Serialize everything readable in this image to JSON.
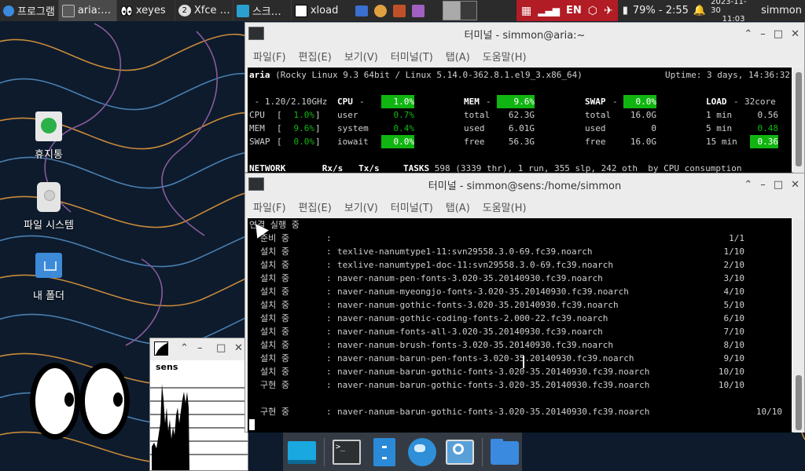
{
  "panel": {
    "apps_menu_label": "프로그램",
    "tasks": [
      {
        "label": "aria:…",
        "icon": "terminal-icon"
      },
      {
        "label": "xeyes",
        "icon": "eyes-icon"
      },
      {
        "label": "Xfce …",
        "icon": "xfce-icon",
        "badge": "2"
      },
      {
        "label": "스크…",
        "icon": "screenshot-icon"
      },
      {
        "label": "xload",
        "icon": "xload-icon"
      }
    ],
    "lang": "EN",
    "battery": "79% - 2:55",
    "date": "2023-11-30",
    "time": "11:03",
    "user": "simmon"
  },
  "desktop_icons": [
    {
      "label": "휴지통",
      "icon": "trash-icon"
    },
    {
      "label": "파일 시스템",
      "icon": "drive-icon"
    },
    {
      "label": "내 폴더",
      "icon": "home-folder-icon"
    }
  ],
  "menu": [
    "파일(F)",
    "편집(E)",
    "보기(V)",
    "터미널(T)",
    "탭(A)",
    "도움말(H)"
  ],
  "win1": {
    "title": "터미널 - simmon@aria:~",
    "host": "aria",
    "sysinfo": " (Rocky Linux 9.3 64bit / Linux 5.14.0-362.8.1.el9_3.x86_64)",
    "uptime": "Uptime: 3 days, 14:36:32",
    "freq": " - 1.20/2.10GHz",
    "cpu_label": "CPU",
    "cpu_pct": "1.0%",
    "cpu_rows": [
      {
        "label": "CPU",
        "bar": "1.0%",
        "name": "user",
        "val": "0.7%"
      },
      {
        "label": "MEM",
        "bar": "9.6%",
        "name": "system",
        "val": "0.4%"
      },
      {
        "label": "SWAP",
        "bar": "0.0%",
        "name": "iowait",
        "val": "0.0%"
      }
    ],
    "mem_label": "MEM",
    "mem_pct": "9.6%",
    "mem_rows": [
      {
        "name": "total",
        "val": "62.3G"
      },
      {
        "name": "used",
        "val": "6.01G"
      },
      {
        "name": "free",
        "val": "56.3G"
      }
    ],
    "swap_label": "SWAP",
    "swap_pct": "0.0%",
    "swap_rows": [
      {
        "name": "total",
        "val": "16.0G"
      },
      {
        "name": "used",
        "val": "0"
      },
      {
        "name": "free",
        "val": "16.0G"
      }
    ],
    "load_label": "LOAD",
    "load_cores": "32core",
    "load_rows": [
      {
        "name": "1 min",
        "val": "0.56"
      },
      {
        "name": "5 min",
        "val": "0.48"
      },
      {
        "name": "15 min",
        "val": "0.36"
      }
    ],
    "network_line": "NETWORK       Rx/s   Tx/s   ",
    "tasks_label": "TASKS",
    "tasks_line": " 598 (3339 thr), 1 run, 355 slp, 242 oth  by CPU consumption"
  },
  "win2": {
    "title": "터미널 - simmon@sens:/home/simmon",
    "header": "연결 실행 중",
    "rows": [
      {
        "action": "준비 중",
        "pkg": "",
        "count": "1/1"
      },
      {
        "action": "설치 중",
        "pkg": "texlive-nanumtype1-11:svn29558.3.0-69.fc39.noarch",
        "count": "1/10"
      },
      {
        "action": "설치 중",
        "pkg": "texlive-nanumtype1-doc-11:svn29558.3.0-69.fc39.noarch",
        "count": "2/10"
      },
      {
        "action": "설치 중",
        "pkg": "naver-nanum-pen-fonts-3.020-35.20140930.fc39.noarch",
        "count": "3/10"
      },
      {
        "action": "설치 중",
        "pkg": "naver-nanum-myeongjo-fonts-3.020-35.20140930.fc39.noarch",
        "count": "4/10"
      },
      {
        "action": "설치 중",
        "pkg": "naver-nanum-gothic-fonts-3.020-35.20140930.fc39.noarch",
        "count": "5/10"
      },
      {
        "action": "설치 중",
        "pkg": "naver-nanum-gothic-coding-fonts-2.000-22.fc39.noarch",
        "count": "6/10"
      },
      {
        "action": "설치 중",
        "pkg": "naver-nanum-fonts-all-3.020-35.20140930.fc39.noarch",
        "count": "7/10"
      },
      {
        "action": "설치 중",
        "pkg": "naver-nanum-brush-fonts-3.020-35.20140930.fc39.noarch",
        "count": "8/10"
      },
      {
        "action": "설치 중",
        "pkg": "naver-nanum-barun-pen-fonts-3.020-35.20140930.fc39.noarch",
        "count": "9/10"
      },
      {
        "action": "설치 중",
        "pkg": "naver-nanum-barun-gothic-fonts-3.020-35.20140930.fc39.noarch",
        "count": "10/10"
      },
      {
        "action": "구현 중",
        "pkg": "naver-nanum-barun-gothic-fonts-3.020-35.20140930.fc39.noarch",
        "count": "10/10"
      }
    ],
    "last_row": {
      "action": "구현 중",
      "pkg": "naver-nanum-barun-gothic-fonts-3.020-35.20140930.fc39.noarch",
      "count": "10/10"
    }
  },
  "xload": {
    "label": "sens"
  },
  "dock": [
    "desktop-icon",
    "terminal-icon",
    "file-manager-icon",
    "web-browser-icon",
    "app-finder-icon",
    "folder-icon"
  ]
}
